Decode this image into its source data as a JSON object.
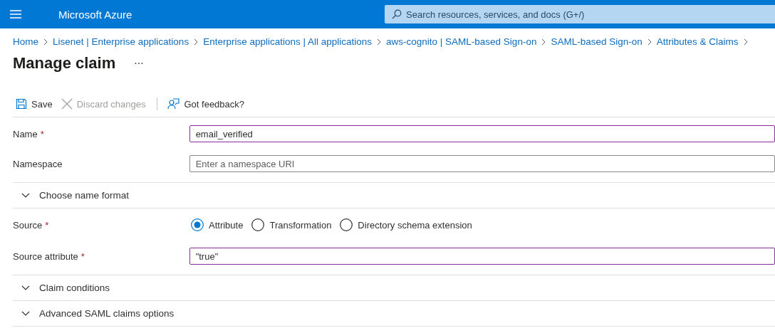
{
  "topbar": {
    "brand": "Microsoft Azure",
    "search": {
      "placeholder": "Search resources, services, and docs (G+/)"
    }
  },
  "breadcrumb": [
    "Home",
    "Lisenet | Enterprise applications",
    "Enterprise applications | All applications",
    "aws-cognito | SAML-based Sign-on",
    "SAML-based Sign-on",
    "Attributes & Claims"
  ],
  "page": {
    "title": "Manage claim",
    "more": "···"
  },
  "toolbar": [
    {
      "kind": "save",
      "label": "Save",
      "disabled": false
    },
    {
      "kind": "discard",
      "label": "Discard changes",
      "disabled": true
    },
    {
      "kind": "feedback",
      "label": "Got feedback?",
      "disabled": false
    }
  ],
  "form": [
    {
      "kind": "field",
      "label": "Name",
      "required_mark": "*",
      "value": "email_verified",
      "modified": true
    },
    {
      "kind": "field",
      "label": "Namespace",
      "placeholder": "Enter a namespace URI",
      "modified": false
    },
    {
      "kind": "section",
      "label": "Choose name format",
      "expanded": false
    },
    {
      "kind": "radio",
      "label": "Source",
      "required_mark": "*",
      "options": [
        {
          "label": "Attribute",
          "selected": true
        },
        {
          "label": "Transformation",
          "selected": false
        },
        {
          "label": "Directory schema extension",
          "selected": false
        }
      ]
    },
    {
      "kind": "field",
      "label": "Source attribute",
      "required_mark": "*",
      "value": "\"true\"",
      "modified": true
    },
    {
      "kind": "section",
      "label": "Claim conditions",
      "expanded": false
    },
    {
      "kind": "section",
      "label": "Advanced SAML claims options",
      "expanded": false
    }
  ]
}
